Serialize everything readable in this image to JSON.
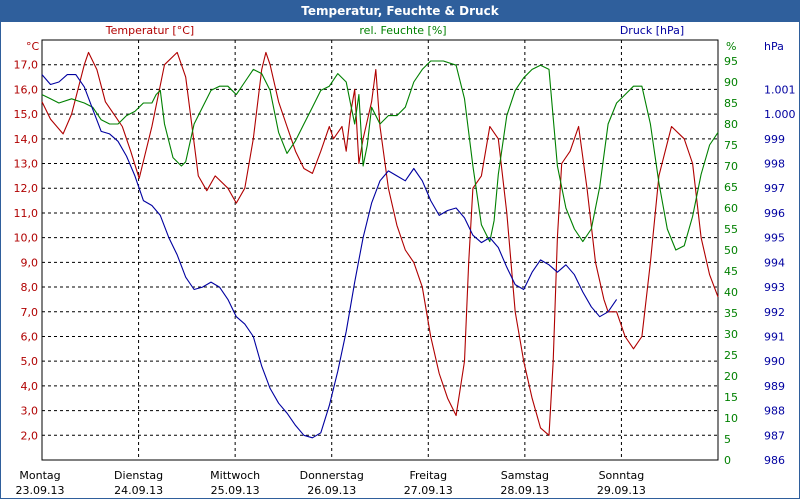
{
  "window": {
    "title": "Temperatur, Feuchte & Druck"
  },
  "chart_data": {
    "type": "line",
    "title": "Temperatur, Feuchte & Druck",
    "axes": {
      "temperature": {
        "label": "Temperatur [°C]",
        "unit": "°C",
        "range": [
          1.0,
          18.0
        ],
        "ticks": [
          "17,0",
          "16,0",
          "15,0",
          "14,0",
          "13,0",
          "12,0",
          "11,0",
          "10,0",
          "9,0",
          "8,0",
          "7,0",
          "6,0",
          "5,0",
          "4,0",
          "3,0",
          "2,0"
        ],
        "tick_values": [
          17,
          16,
          15,
          14,
          13,
          12,
          11,
          10,
          9,
          8,
          7,
          6,
          5,
          4,
          3,
          2
        ],
        "color": "#b00000"
      },
      "humidity": {
        "label": "rel. Feuchte [%]",
        "unit": "%",
        "range": [
          0,
          100
        ],
        "ticks": [
          "95",
          "90",
          "85",
          "80",
          "75",
          "70",
          "65",
          "60",
          "55",
          "50",
          "45",
          "40",
          "35",
          "30",
          "25",
          "20",
          "15",
          "10",
          "5",
          "0"
        ],
        "tick_values": [
          95,
          90,
          85,
          80,
          75,
          70,
          65,
          60,
          55,
          50,
          45,
          40,
          35,
          30,
          25,
          20,
          15,
          10,
          5,
          0
        ],
        "color": "#008000"
      },
      "pressure": {
        "label": "Druck [hPa]",
        "unit": "hPa",
        "range": [
          986,
          1003
        ],
        "ticks": [
          "1.001",
          "1.000",
          "999",
          "998",
          "997",
          "996",
          "995",
          "994",
          "993",
          "992",
          "991",
          "990",
          "989",
          "988",
          "987",
          "986"
        ],
        "tick_values": [
          1001,
          1000,
          999,
          998,
          997,
          996,
          995,
          994,
          993,
          992,
          991,
          990,
          989,
          988,
          987,
          986
        ],
        "color": "#0000a0"
      }
    },
    "x": {
      "range": [
        0,
        7
      ],
      "days": [
        {
          "day": "Montag",
          "date": "23.09.13"
        },
        {
          "day": "Dienstag",
          "date": "24.09.13"
        },
        {
          "day": "Mittwoch",
          "date": "25.09.13"
        },
        {
          "day": "Donnerstag",
          "date": "26.09.13"
        },
        {
          "day": "Freitag",
          "date": "27.09.13"
        },
        {
          "day": "Samstag",
          "date": "28.09.13"
        },
        {
          "day": "Sonntag",
          "date": "29.09.13"
        }
      ]
    },
    "grid": true,
    "series": [
      {
        "name": "Temperatur [°C]",
        "axis": "temperature",
        "color": "#b00000",
        "points": [
          [
            0,
            15.5
          ],
          [
            0.1,
            14.8
          ],
          [
            0.25,
            14.2
          ],
          [
            0.35,
            15.0
          ],
          [
            0.5,
            17.0
          ],
          [
            0.55,
            17.5
          ],
          [
            0.65,
            16.8
          ],
          [
            0.75,
            15.5
          ],
          [
            0.85,
            15.0
          ],
          [
            0.95,
            14.5
          ],
          [
            1.05,
            13.5
          ],
          [
            1.15,
            12.4
          ],
          [
            1.3,
            14.5
          ],
          [
            1.45,
            17.0
          ],
          [
            1.6,
            17.5
          ],
          [
            1.7,
            16.5
          ],
          [
            1.85,
            12.5
          ],
          [
            1.95,
            11.9
          ],
          [
            2.05,
            12.5
          ],
          [
            2.2,
            12.0
          ],
          [
            2.3,
            11.4
          ],
          [
            2.4,
            12.0
          ],
          [
            2.5,
            14.0
          ],
          [
            2.6,
            16.8
          ],
          [
            2.65,
            17.5
          ],
          [
            2.7,
            17.0
          ],
          [
            2.8,
            15.5
          ],
          [
            2.9,
            14.5
          ],
          [
            3.0,
            13.5
          ],
          [
            3.1,
            12.8
          ],
          [
            3.2,
            12.6
          ],
          [
            3.3,
            13.5
          ],
          [
            3.4,
            14.5
          ],
          [
            3.45,
            14.0
          ],
          [
            3.55,
            14.5
          ],
          [
            3.6,
            13.5
          ],
          [
            3.65,
            15.0
          ],
          [
            3.7,
            16.0
          ],
          [
            3.75,
            13.0
          ],
          [
            3.8,
            14.0
          ],
          [
            3.9,
            15.5
          ],
          [
            3.95,
            16.8
          ],
          [
            4.0,
            14.5
          ],
          [
            4.1,
            12.0
          ],
          [
            4.2,
            10.5
          ],
          [
            4.3,
            9.5
          ],
          [
            4.4,
            9.0
          ],
          [
            4.5,
            8.0
          ],
          [
            4.6,
            6.0
          ],
          [
            4.7,
            4.5
          ],
          [
            4.8,
            3.5
          ],
          [
            4.9,
            2.8
          ],
          [
            5.0,
            5.0
          ],
          [
            5.05,
            9.0
          ],
          [
            5.1,
            12.0
          ],
          [
            5.2,
            12.5
          ],
          [
            5.3,
            14.5
          ],
          [
            5.4,
            14.0
          ],
          [
            5.5,
            11.0
          ],
          [
            5.6,
            7.0
          ],
          [
            5.7,
            5.0
          ],
          [
            5.8,
            3.5
          ],
          [
            5.9,
            2.3
          ],
          [
            6.0,
            2.0
          ],
          [
            6.05,
            5.0
          ],
          [
            6.1,
            10.0
          ],
          [
            6.15,
            13.0
          ],
          [
            6.25,
            13.5
          ],
          [
            6.35,
            14.5
          ],
          [
            6.45,
            12.0
          ],
          [
            6.55,
            9.0
          ],
          [
            6.65,
            7.5
          ],
          [
            6.7,
            7.0
          ],
          [
            6.8,
            7.0
          ],
          [
            6.9,
            6.0
          ],
          [
            7.0,
            5.5
          ],
          [
            7.1,
            6.0
          ],
          [
            7.2,
            9.0
          ],
          [
            7.3,
            12.5
          ],
          [
            7.45,
            14.5
          ],
          [
            7.6,
            14.0
          ],
          [
            7.7,
            13.0
          ],
          [
            7.8,
            10.0
          ],
          [
            7.9,
            8.5
          ],
          [
            8.0,
            7.6
          ]
        ]
      },
      {
        "name": "rel. Feuchte [%]",
        "axis": "humidity",
        "color": "#008000",
        "points": [
          [
            0,
            87
          ],
          [
            0.1,
            86
          ],
          [
            0.2,
            85
          ],
          [
            0.35,
            86
          ],
          [
            0.5,
            85
          ],
          [
            0.6,
            84
          ],
          [
            0.7,
            81
          ],
          [
            0.8,
            80
          ],
          [
            0.9,
            80
          ],
          [
            1.0,
            82
          ],
          [
            1.1,
            83
          ],
          [
            1.2,
            85
          ],
          [
            1.3,
            85
          ],
          [
            1.35,
            87
          ],
          [
            1.4,
            88
          ],
          [
            1.45,
            80
          ],
          [
            1.55,
            72
          ],
          [
            1.65,
            70
          ],
          [
            1.7,
            71
          ],
          [
            1.8,
            80
          ],
          [
            1.9,
            84
          ],
          [
            2.0,
            88
          ],
          [
            2.1,
            89
          ],
          [
            2.2,
            89
          ],
          [
            2.3,
            87
          ],
          [
            2.4,
            90
          ],
          [
            2.5,
            93
          ],
          [
            2.6,
            92
          ],
          [
            2.7,
            88
          ],
          [
            2.8,
            78
          ],
          [
            2.9,
            73
          ],
          [
            3.0,
            76
          ],
          [
            3.1,
            80
          ],
          [
            3.2,
            84
          ],
          [
            3.3,
            88
          ],
          [
            3.4,
            89
          ],
          [
            3.5,
            92
          ],
          [
            3.6,
            90
          ],
          [
            3.65,
            85
          ],
          [
            3.7,
            80
          ],
          [
            3.75,
            87
          ],
          [
            3.8,
            70
          ],
          [
            3.85,
            75
          ],
          [
            3.9,
            84
          ],
          [
            4.0,
            80
          ],
          [
            4.1,
            82
          ],
          [
            4.2,
            82
          ],
          [
            4.3,
            84
          ],
          [
            4.4,
            90
          ],
          [
            4.5,
            93
          ],
          [
            4.6,
            95
          ],
          [
            4.75,
            95
          ],
          [
            4.9,
            94
          ],
          [
            5.0,
            86
          ],
          [
            5.1,
            70
          ],
          [
            5.2,
            56
          ],
          [
            5.3,
            52
          ],
          [
            5.35,
            57
          ],
          [
            5.4,
            68
          ],
          [
            5.5,
            82
          ],
          [
            5.6,
            88
          ],
          [
            5.7,
            91
          ],
          [
            5.8,
            93
          ],
          [
            5.9,
            94
          ],
          [
            6.0,
            93
          ],
          [
            6.1,
            70
          ],
          [
            6.2,
            60
          ],
          [
            6.3,
            55
          ],
          [
            6.4,
            52
          ],
          [
            6.5,
            55
          ],
          [
            6.6,
            65
          ],
          [
            6.7,
            80
          ],
          [
            6.8,
            85
          ],
          [
            6.9,
            87
          ],
          [
            7.0,
            89
          ],
          [
            7.1,
            89
          ],
          [
            7.2,
            80
          ],
          [
            7.3,
            66
          ],
          [
            7.4,
            55
          ],
          [
            7.5,
            50
          ],
          [
            7.6,
            51
          ],
          [
            7.7,
            58
          ],
          [
            7.8,
            68
          ],
          [
            7.9,
            75
          ],
          [
            8.0,
            78
          ]
        ]
      },
      {
        "name": "Druck [hPa]",
        "axis": "pressure",
        "color": "#0000a0",
        "points": [
          [
            0,
            1001.6
          ],
          [
            0.1,
            1001.2
          ],
          [
            0.2,
            1001.3
          ],
          [
            0.3,
            1001.6
          ],
          [
            0.4,
            1001.6
          ],
          [
            0.5,
            1001.1
          ],
          [
            0.6,
            1000.2
          ],
          [
            0.7,
            999.3
          ],
          [
            0.8,
            999.2
          ],
          [
            0.9,
            998.9
          ],
          [
            1.0,
            998.3
          ],
          [
            1.1,
            997.5
          ],
          [
            1.2,
            996.5
          ],
          [
            1.3,
            996.3
          ],
          [
            1.4,
            995.9
          ],
          [
            1.5,
            995.0
          ],
          [
            1.6,
            994.3
          ],
          [
            1.7,
            993.4
          ],
          [
            1.8,
            992.9
          ],
          [
            1.9,
            993.0
          ],
          [
            2.0,
            993.2
          ],
          [
            2.1,
            993.0
          ],
          [
            2.2,
            992.5
          ],
          [
            2.3,
            991.8
          ],
          [
            2.4,
            991.5
          ],
          [
            2.5,
            991.0
          ],
          [
            2.6,
            989.8
          ],
          [
            2.7,
            988.9
          ],
          [
            2.8,
            988.3
          ],
          [
            2.9,
            987.9
          ],
          [
            3.0,
            987.4
          ],
          [
            3.1,
            987.0
          ],
          [
            3.2,
            986.9
          ],
          [
            3.3,
            987.1
          ],
          [
            3.4,
            988.2
          ],
          [
            3.5,
            989.6
          ],
          [
            3.6,
            991.2
          ],
          [
            3.7,
            993.2
          ],
          [
            3.8,
            995.0
          ],
          [
            3.9,
            996.4
          ],
          [
            4.0,
            997.3
          ],
          [
            4.1,
            997.7
          ],
          [
            4.2,
            997.5
          ],
          [
            4.3,
            997.3
          ],
          [
            4.4,
            997.8
          ],
          [
            4.5,
            997.3
          ],
          [
            4.6,
            996.5
          ],
          [
            4.7,
            995.9
          ],
          [
            4.8,
            996.1
          ],
          [
            4.9,
            996.2
          ],
          [
            5.0,
            995.8
          ],
          [
            5.1,
            995.1
          ],
          [
            5.2,
            994.8
          ],
          [
            5.3,
            995.0
          ],
          [
            5.4,
            994.6
          ],
          [
            5.5,
            993.8
          ],
          [
            5.6,
            993.1
          ],
          [
            5.7,
            992.9
          ],
          [
            5.8,
            993.6
          ],
          [
            5.9,
            994.1
          ],
          [
            6.0,
            993.9
          ],
          [
            6.1,
            993.6
          ],
          [
            6.2,
            993.9
          ],
          [
            6.3,
            993.5
          ],
          [
            6.4,
            992.8
          ],
          [
            6.5,
            992.2
          ],
          [
            6.6,
            991.8
          ],
          [
            6.7,
            992.0
          ],
          [
            6.8,
            992.5
          ]
        ]
      }
    ]
  }
}
